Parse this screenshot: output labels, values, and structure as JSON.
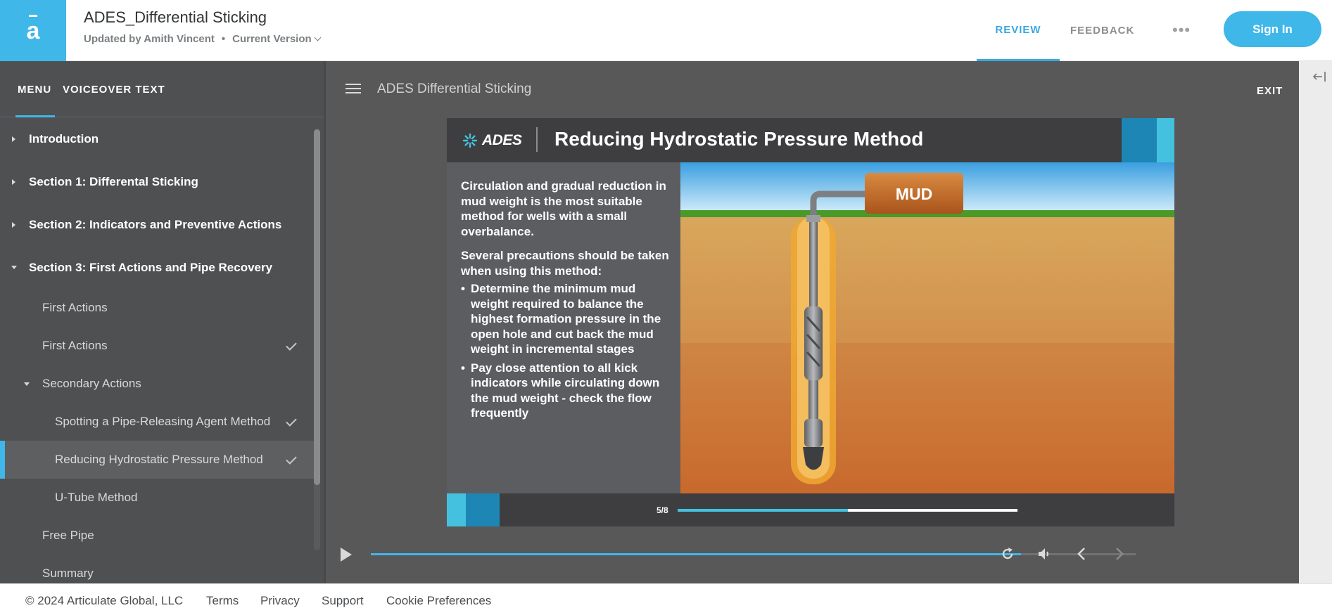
{
  "header": {
    "logo_letter": "a",
    "title": "ADES_Differential Sticking",
    "updated_by": "Updated by Amith Vincent",
    "separator": "•",
    "version": "Current Version",
    "nav_review": "REVIEW",
    "nav_feedback": "FEEDBACK",
    "more": "•••",
    "sign_in": "Sign In",
    "brand_color": "#3fb7e8"
  },
  "sidebar": {
    "tab_menu": "MENU",
    "tab_voiceover": "VOICEOVER TEXT",
    "items": [
      {
        "label": "Introduction",
        "type": "section",
        "expanded": false
      },
      {
        "label": "Section 1: Differental Sticking",
        "type": "section",
        "expanded": false
      },
      {
        "label": "Section 2: Indicators and Preventive Actions",
        "type": "section",
        "expanded": false
      },
      {
        "label": "Section 3: First Actions and Pipe Recovery",
        "type": "section",
        "expanded": true
      },
      {
        "label": "First Actions",
        "type": "lesson",
        "checked": false
      },
      {
        "label": "First Actions",
        "type": "lesson",
        "checked": true
      },
      {
        "label": "Secondary Actions",
        "type": "group",
        "expanded": true
      },
      {
        "label": "Spotting a Pipe-Releasing Agent Method",
        "type": "lesson",
        "checked": true
      },
      {
        "label": "Reducing Hydrostatic Pressure Method",
        "type": "lesson",
        "checked": true,
        "active": true
      },
      {
        "label": "U-Tube Method",
        "type": "lesson",
        "checked": false
      },
      {
        "label": "Free Pipe",
        "type": "lesson",
        "checked": false
      },
      {
        "label": "Summary",
        "type": "lesson",
        "checked": false
      }
    ]
  },
  "player": {
    "course_title": "ADES Differential Sticking",
    "exit": "EXIT",
    "playback_progress": 0.85
  },
  "slide": {
    "logo_text": "ADES",
    "title": "Reducing Hydrostatic Pressure Method",
    "para1": "Circulation and gradual reduction in mud weight is the most suitable method for wells with a small overbalance.",
    "para2": "Several precautions should be taken when using this method:",
    "bullets": [
      "Determine the minimum mud weight required to balance the highest formation pressure in the open hole and cut back the mud weight in incremental stages",
      "Pay close attention to all kick indicators while circulating down the mud weight - check the flow frequently"
    ],
    "image_label": "MUD",
    "counter": "5/8",
    "progress": 0.5,
    "accent_dark": "#1e86b5",
    "accent_light": "#44c1de"
  },
  "footer": {
    "copyright": "© 2024 Articulate Global, LLC",
    "terms": "Terms",
    "privacy": "Privacy",
    "support": "Support",
    "cookies": "Cookie Preferences"
  }
}
